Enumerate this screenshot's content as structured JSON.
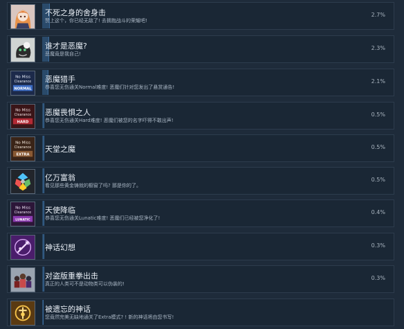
{
  "achievements": [
    {
      "title": "不死之身的舍身击",
      "desc": "赞上这个，你已经无敌了! 去拥抱战斗的荣耀吧!",
      "percent": "2.7%",
      "icon": "anime-girl-icon",
      "progress": 0.027
    },
    {
      "title": "谁才是恶魔?",
      "desc": "恶魔竟是我自己!",
      "percent": "2.3%",
      "icon": "demon-mask-icon",
      "progress": 0.023
    },
    {
      "title": "恶魔猎手",
      "desc": "恭喜您无伤通关Normal难度! 恶魔们针对您发出了悬赏通告!",
      "percent": "2.1%",
      "icon": "no-miss-normal-icon",
      "progress": 0.021
    },
    {
      "title": "恶魔畏惧之人",
      "desc": "恭喜您无伤通关Hard难度! 恶魔们被您的名字吓得不敢出声!",
      "percent": "0.5%",
      "icon": "no-miss-hard-icon",
      "progress": 0.005
    },
    {
      "title": "天堂之魔",
      "desc": "",
      "percent": "0.5%",
      "icon": "no-miss-extra-icon",
      "progress": 0.005
    },
    {
      "title": "亿万富翁",
      "desc": "看见那些黄金铸就的橱窗了吗? 那是你的了。",
      "percent": "0.5%",
      "icon": "colorful-gems-icon",
      "progress": 0.005
    },
    {
      "title": "天使降临",
      "desc": "恭喜您无伤通关Lunatic难度! 恶魔们已经被您净化了!",
      "percent": "0.4%",
      "icon": "no-miss-lunatic-icon",
      "progress": 0.004
    },
    {
      "title": "神话幻想",
      "desc": "",
      "percent": "0.3%",
      "icon": "purple-emblem-icon",
      "progress": 0.003
    },
    {
      "title": "对盗版重拳出击",
      "desc": "真正的人类可不是动物类可以伪装的!",
      "percent": "0.3%",
      "icon": "three-figures-icon",
      "progress": 0.003
    },
    {
      "title": "被遗忘的神话",
      "desc": "您竟然完美无缺地通关了Extra模式? ! 新的神话将由您书写!",
      "percent": "",
      "icon": "golden-rune-icon",
      "progress": 0.0
    }
  ],
  "icon_labels": {
    "no_miss": "No Miss",
    "clearance": "Clearance",
    "normal": "NORMAL",
    "hard": "HARD",
    "extra": "EXTRA",
    "lunatic": "LUNATIC"
  },
  "colors": {
    "background": "#1b2838",
    "row": "#1a2735",
    "progress": "#2a4a6a",
    "title": "#e8eef5",
    "desc": "#a9b6c4"
  }
}
